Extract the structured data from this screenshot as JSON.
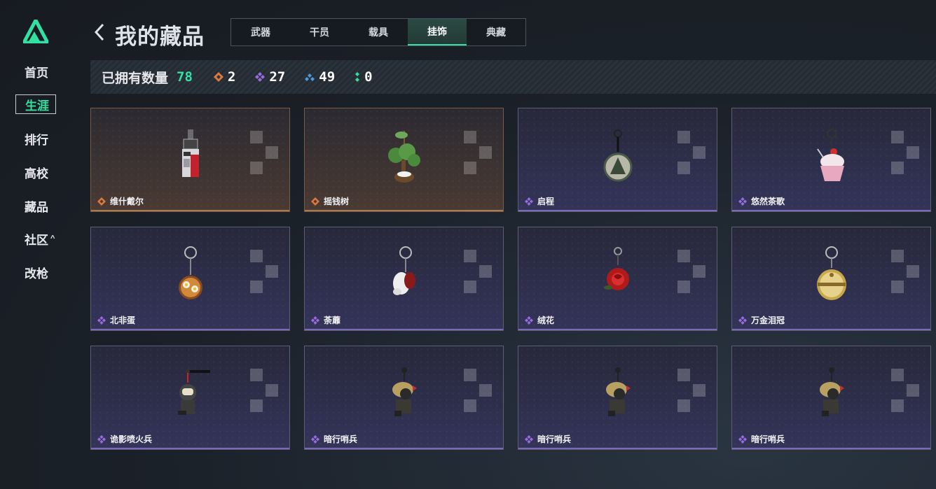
{
  "sidebar": {
    "items": [
      {
        "label": "首页"
      },
      {
        "label": "生涯",
        "active": true
      },
      {
        "label": "排行"
      },
      {
        "label": "高校"
      },
      {
        "label": "藏品"
      },
      {
        "label": "社区",
        "caret": "^"
      },
      {
        "label": "改枪"
      }
    ]
  },
  "header": {
    "title": "我的藏品",
    "tabs": [
      {
        "label": "武器"
      },
      {
        "label": "干员"
      },
      {
        "label": "载具"
      },
      {
        "label": "挂饰",
        "active": true
      },
      {
        "label": "典藏"
      }
    ]
  },
  "stats": {
    "owned_label": "已拥有数量",
    "owned_total": "78",
    "rarities": [
      {
        "icon": "orange-diamond-icon",
        "color": "#e07a3c",
        "value": "2"
      },
      {
        "icon": "purple-diamond-icon",
        "color": "#9a6ce0",
        "value": "27"
      },
      {
        "icon": "blue-diamond-icon",
        "color": "#4a9ce0",
        "value": "49"
      },
      {
        "icon": "green-dots-icon",
        "color": "#33e0a1",
        "value": "0"
      }
    ]
  },
  "items": [
    {
      "name": "维什戴尔",
      "rarity": "orange",
      "icon": "red-device-charm-icon"
    },
    {
      "name": "摇钱树",
      "rarity": "orange",
      "icon": "money-tree-charm-icon"
    },
    {
      "name": "启程",
      "rarity": "purple",
      "icon": "medal-charm-icon"
    },
    {
      "name": "悠然茶歌",
      "rarity": "purple",
      "icon": "cupcake-charm-icon"
    },
    {
      "name": "北非蛋",
      "rarity": "purple",
      "icon": "shakshuka-charm-icon"
    },
    {
      "name": "荼蘼",
      "rarity": "purple",
      "icon": "white-flower-charm-icon"
    },
    {
      "name": "绒花",
      "rarity": "purple",
      "icon": "red-rose-charm-icon"
    },
    {
      "name": "万金泪冠",
      "rarity": "purple",
      "icon": "gold-crown-charm-icon"
    },
    {
      "name": "诡影喷火兵",
      "rarity": "purple",
      "icon": "flamethrower-soldier-charm-icon"
    },
    {
      "name": "暗行哨兵",
      "rarity": "purple",
      "icon": "sentinel-soldier-charm-icon"
    },
    {
      "name": "暗行哨兵",
      "rarity": "purple",
      "icon": "sentinel-soldier-charm-icon"
    },
    {
      "name": "暗行哨兵",
      "rarity": "purple",
      "icon": "sentinel-soldier-charm-icon"
    }
  ],
  "colors": {
    "accent": "#33e0a1",
    "rarity_orange": "#e07a3c",
    "rarity_purple": "#9a6ce0"
  }
}
